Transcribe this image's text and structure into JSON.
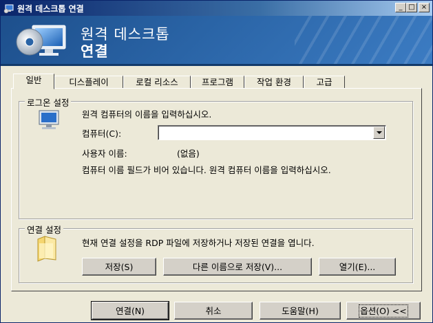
{
  "window": {
    "title": "원격 데스크톱 연결",
    "controls": {
      "minimize": "_",
      "maximize": "□",
      "close": "×"
    }
  },
  "banner": {
    "line1": "원격 데스크톱",
    "line2": "연결"
  },
  "tabs": [
    {
      "label": "일반",
      "active": true
    },
    {
      "label": "디스플레이",
      "active": false
    },
    {
      "label": "로컬 리소스",
      "active": false
    },
    {
      "label": "프로그램",
      "active": false
    },
    {
      "label": "작업 환경",
      "active": false
    },
    {
      "label": "고급",
      "active": false
    }
  ],
  "logon": {
    "legend": "로그온 설정",
    "instruction": "원격 컴퓨터의 이름을 입력하십시오.",
    "computer_label": "컴퓨터(C):",
    "computer_value": "",
    "user_label": "사용자 이름:",
    "user_value": "(없음)",
    "hint": "컴퓨터 이름 필드가 비어 있습니다. 원격 컴퓨터 이름을 입력하십시오."
  },
  "connection": {
    "legend": "연결 설정",
    "description": "현재 연결 설정을 RDP 파일에 저장하거나 저장된 연결을 엽니다.",
    "save_label": "저장(S)",
    "save_as_label": "다른 이름으로 저장(V)...",
    "open_label": "열기(E)..."
  },
  "footer": {
    "connect_label": "연결(N)",
    "cancel_label": "취소",
    "help_label": "도움말(H)",
    "options_label": "옵션(O) <<"
  }
}
